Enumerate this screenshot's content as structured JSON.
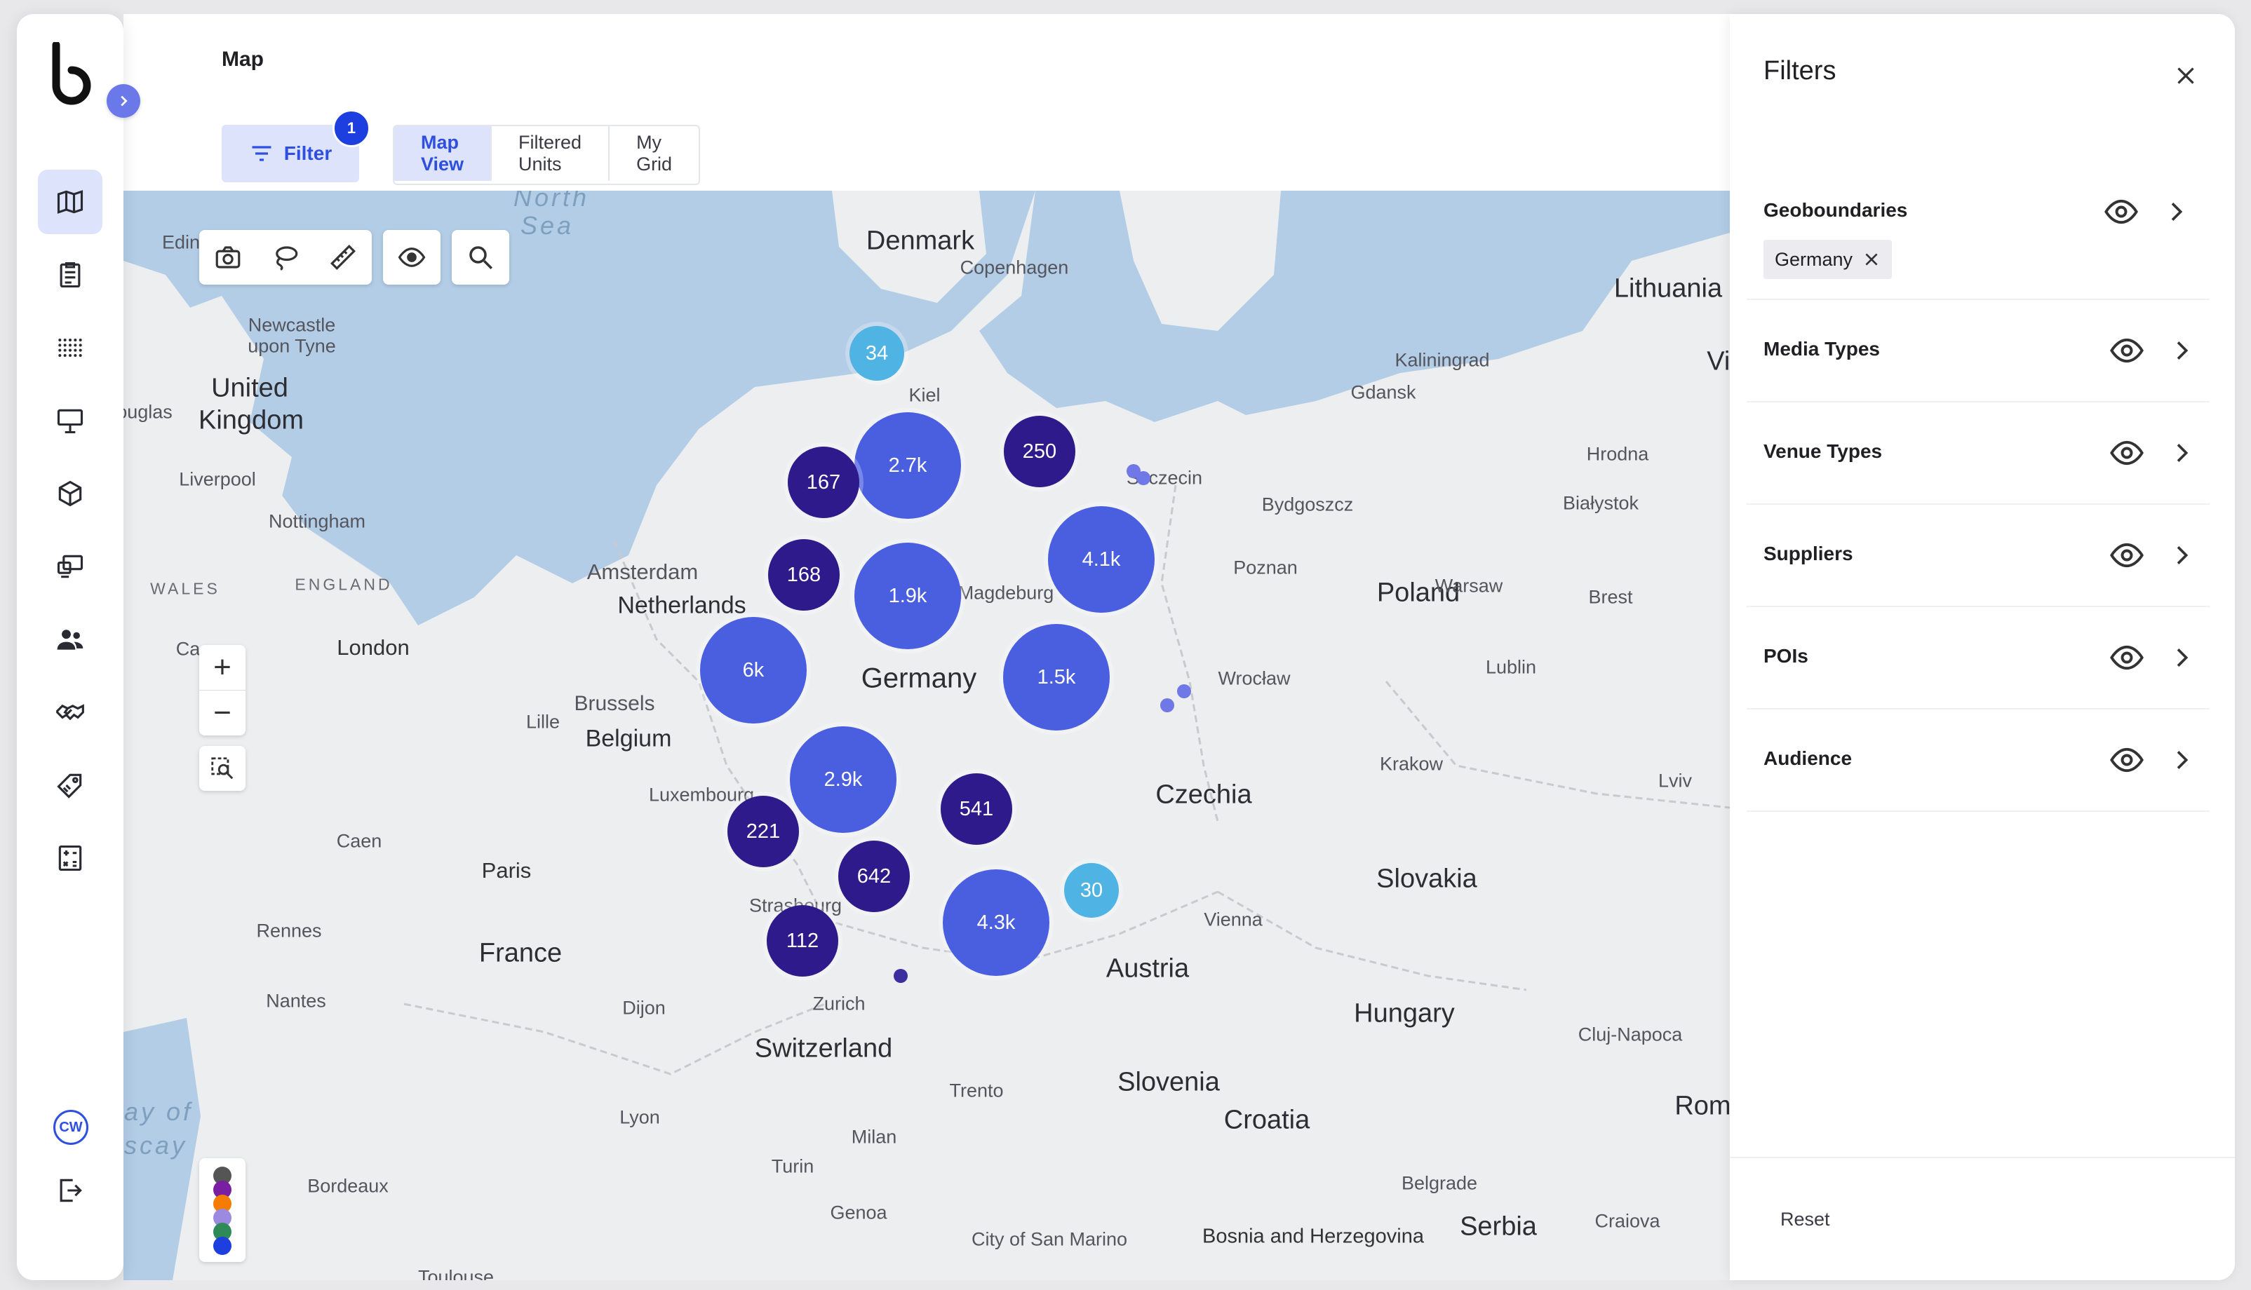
{
  "header": {
    "title": "Map"
  },
  "toolbar": {
    "filter_label": "Filter",
    "filter_badge": "1",
    "tabs": [
      {
        "label": "Map View",
        "active": true
      },
      {
        "label": "Filtered Units",
        "active": false
      },
      {
        "label": "My Grid",
        "active": false
      }
    ]
  },
  "sidebar": {
    "items": [
      {
        "icon": "map-icon",
        "active": true
      },
      {
        "icon": "clipboard-icon"
      },
      {
        "icon": "grid-dots-icon"
      },
      {
        "icon": "billboard-icon"
      },
      {
        "icon": "cube-icon"
      },
      {
        "icon": "screens-icon"
      },
      {
        "icon": "people-icon"
      },
      {
        "icon": "handshake-icon"
      },
      {
        "icon": "tag-icon"
      },
      {
        "icon": "calculator-icon"
      }
    ],
    "avatar_initials": "CW",
    "logout_icon": "logout-icon"
  },
  "map": {
    "places": {
      "denmark": "Denmark",
      "copenhagen": "Copenhagen",
      "kiel": "Kiel",
      "szczecin": "Szczecin",
      "lithuania": "Lithuania",
      "kaliningrad": "Kaliningrad",
      "gdansk": "Gdansk",
      "vil": "Vil",
      "hrodna": "Hrodna",
      "bialystok": "Białystok",
      "bydgoszcz": "Bydgoszcz",
      "poznan": "Poznan",
      "poland": "Poland",
      "warsaw": "Warsaw",
      "brest": "Brest",
      "lublin": "Lublin",
      "wroclaw": "Wrocław",
      "krakow": "Krakow",
      "lviv": "Lviv",
      "czechia": "Czechia",
      "slovakia": "Slovakia",
      "vienna": "Vienna",
      "austria": "Austria",
      "hungary": "Hungary",
      "cluj": "Cluj-Napoca",
      "roma": "Roma",
      "slovenia": "Slovenia",
      "croatia": "Croatia",
      "belgrade": "Belgrade",
      "serbia": "Serbia",
      "craiova": "Craiova",
      "bosnia": "Bosnia and Herzegovina",
      "sanmarino": "City of San Marino",
      "trento": "Trento",
      "milan": "Milan",
      "turin": "Turin",
      "genoa": "Genoa",
      "switzerland": "Switzerland",
      "zurich": "Zurich",
      "strasbourg": "Strasbourg",
      "luxembourg": "Luxembourg",
      "dijon": "Dijon",
      "lyon": "Lyon",
      "bordeaux": "Bordeaux",
      "toulouse": "Toulouse",
      "france": "France",
      "paris": "Paris",
      "nantes": "Nantes",
      "rennes": "Rennes",
      "caen": "Caen",
      "lille": "Lille",
      "brussels": "Brussels",
      "belgium": "Belgium",
      "amsterdam": "Amsterdam",
      "netherlands": "Netherlands",
      "magdeburg": "Magdeburg",
      "germany": "Germany",
      "london": "London",
      "england": "ENGLAND",
      "wales": "WALES",
      "nottingham": "Nottingham",
      "liverpool": "Liverpool",
      "uk1": "United",
      "uk2": "Kingdom",
      "douglas": "ouglas",
      "newcastle1": "Newcastle",
      "newcastle2": "upon Tyne",
      "edin": "Edin",
      "ca": "Ca",
      "northsea1": "North",
      "northsea2": "Sea",
      "biscay1": "ay of",
      "biscay2": "scay"
    },
    "clusters": [
      {
        "label": "34",
        "tier": "small"
      },
      {
        "label": "2.7k",
        "tier": "large"
      },
      {
        "label": "250",
        "tier": "medium"
      },
      {
        "label": "167",
        "tier": "medium"
      },
      {
        "label": "168",
        "tier": "medium"
      },
      {
        "label": "1.9k",
        "tier": "large"
      },
      {
        "label": "4.1k",
        "tier": "large"
      },
      {
        "label": "6k",
        "tier": "large"
      },
      {
        "label": "1.5k",
        "tier": "large"
      },
      {
        "label": "2.9k",
        "tier": "large"
      },
      {
        "label": "541",
        "tier": "medium"
      },
      {
        "label": "221",
        "tier": "medium"
      },
      {
        "label": "642",
        "tier": "medium"
      },
      {
        "label": "30",
        "tier": "small"
      },
      {
        "label": "4.3k",
        "tier": "large"
      },
      {
        "label": "112",
        "tier": "medium"
      }
    ],
    "colors": {
      "small": "#4fb3e3",
      "medium": "#2e1a8a",
      "large": "#4a5ee0",
      "water": "#b3cde6",
      "land": "#eceef0"
    },
    "legend_colors": [
      "#555555",
      "#7b1fa2",
      "#f57c00",
      "#9c8ae0",
      "#2e8b57",
      "#1d3fe0"
    ]
  },
  "filters": {
    "title": "Filters",
    "sections": [
      {
        "label": "Geoboundaries",
        "chip": "Germany"
      },
      {
        "label": "Media Types"
      },
      {
        "label": "Venue Types"
      },
      {
        "label": "Suppliers"
      },
      {
        "label": "POIs"
      },
      {
        "label": "Audience"
      }
    ],
    "reset_label": "Reset"
  }
}
